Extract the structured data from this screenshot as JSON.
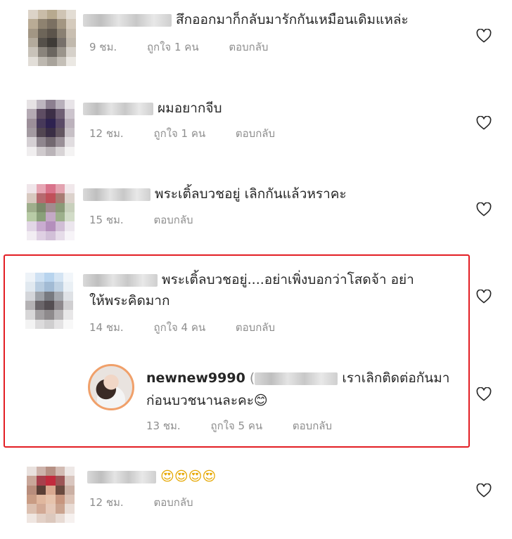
{
  "comments": [
    {
      "text": "สึกออกมาก็กลับมารักกันเหมือนเดิมแหล่ะ",
      "time": "9 ชม.",
      "likes": "ถูกใจ 1 คน",
      "reply": "ตอบกลับ"
    },
    {
      "text": "ผมอยากจีบ",
      "time": "12 ชม.",
      "likes": "ถูกใจ 1 คน",
      "reply": "ตอบกลับ"
    },
    {
      "text": "พระเติ้ลบวชอยู่ เลิกกันแล้วหราคะ",
      "time": "15 ชม.",
      "reply": "ตอบกลับ"
    },
    {
      "text_line1": "พระเติ้ลบวชอยู่....อย่าเพิ่งบอกว่าโสดจ้า  อย่า",
      "text_line2": "ให้พระคิดมาก",
      "time": "14 ชม.",
      "likes": "ถูกใจ 4 คน",
      "reply": "ตอบกลับ"
    },
    {
      "text": "😍😍😍😍",
      "time": "12 ชม.",
      "reply": "ตอบกลับ"
    }
  ],
  "reply_comment": {
    "username": "newnew9990",
    "paren": "(",
    "text_line1": "เราเลิกติดต่อกันมา",
    "text_line2": "ก่อนบวชนานละคะ😊",
    "time": "13 ชม.",
    "likes": "ถูกใจ 5 คน",
    "reply": "ตอบกลับ"
  },
  "icons": {
    "like": "heart-outline-icon"
  },
  "colors": {
    "highlight_border": "#e31e24",
    "meta_text": "#8e8e8e"
  }
}
